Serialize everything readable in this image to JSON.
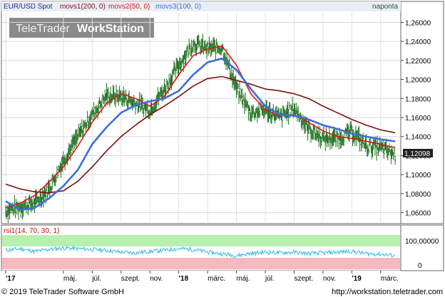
{
  "header": {
    "symbol": "EUR/USD Spot",
    "ma1": "movs1(200, 0)",
    "ma2": "movs2(50, 0)",
    "ma3": "movs3(100, 0)",
    "period": "naponta"
  },
  "watermark": {
    "brand": "TeleTrader",
    "product": "WorkStation"
  },
  "last_price": "1,12098",
  "rsi_panel": {
    "label": "rsi1(14, 70, 30, 1)",
    "ticks": [
      "100,00000",
      "0"
    ]
  },
  "x_axis_labels": [
    "'17",
    "máj.",
    "júl.",
    "szept.",
    "nov.",
    "'18",
    "márc.",
    "máj.",
    "júl.",
    "szept.",
    "nov.",
    "'19",
    "márc."
  ],
  "y_axis_labels": [
    "1,26000",
    "1,24000",
    "1,22000",
    "1,20000",
    "1,18000",
    "1,16000",
    "1,14000",
    "1,12000",
    "1,10000",
    "1,08000",
    "1,06000"
  ],
  "footer": {
    "copyright": "© 2019 TeleTrader Software GmbH",
    "url": "http://workstation.teletrader.com"
  },
  "colors": {
    "price": "#1c6e1c",
    "ma_200": "#7a1010",
    "ma_50": "#d61a1a",
    "ma_100": "#3a6fd9",
    "rsi": "#33b8e8",
    "rsi_overbought": "#b8f0b0",
    "rsi_oversold": "#f6b9c0"
  },
  "chart_data": {
    "type": "line",
    "ylim": [
      1.05,
      1.27
    ],
    "x_months": [
      "2017-01",
      "2017-02",
      "2017-03",
      "2017-04",
      "2017-05",
      "2017-06",
      "2017-07",
      "2017-08",
      "2017-09",
      "2017-10",
      "2017-11",
      "2017-12",
      "2018-01",
      "2018-02",
      "2018-03",
      "2018-04",
      "2018-05",
      "2018-06",
      "2018-07",
      "2018-08",
      "2018-09",
      "2018-10",
      "2018-11",
      "2018-12",
      "2019-01",
      "2019-02",
      "2019-03",
      "2019-04"
    ],
    "series": [
      {
        "name": "EUR/USD Spot",
        "style": "ohlc",
        "values": [
          1.062,
          1.066,
          1.07,
          1.085,
          1.115,
          1.14,
          1.163,
          1.183,
          1.182,
          1.175,
          1.168,
          1.19,
          1.215,
          1.238,
          1.232,
          1.234,
          1.19,
          1.165,
          1.168,
          1.16,
          1.17,
          1.148,
          1.138,
          1.138,
          1.145,
          1.13,
          1.128,
          1.121
        ]
      },
      {
        "name": "movs1(200, 0)",
        "values": [
          1.09,
          1.085,
          1.082,
          1.081,
          1.083,
          1.093,
          1.108,
          1.125,
          1.14,
          1.152,
          1.163,
          1.172,
          1.182,
          1.193,
          1.201,
          1.203,
          1.199,
          1.195,
          1.19,
          1.188,
          1.185,
          1.18,
          1.172,
          1.165,
          1.158,
          1.152,
          1.147,
          1.144
        ]
      },
      {
        "name": "movs2(50, 0)",
        "values": [
          1.065,
          1.07,
          1.078,
          1.092,
          1.108,
          1.13,
          1.155,
          1.175,
          1.185,
          1.18,
          1.172,
          1.182,
          1.205,
          1.225,
          1.232,
          1.235,
          1.215,
          1.185,
          1.168,
          1.162,
          1.163,
          1.155,
          1.146,
          1.14,
          1.138,
          1.135,
          1.132,
          1.128
        ]
      },
      {
        "name": "movs3(100, 0)",
        "values": [
          1.072,
          1.063,
          1.065,
          1.075,
          1.088,
          1.105,
          1.132,
          1.15,
          1.165,
          1.173,
          1.177,
          1.18,
          1.188,
          1.205,
          1.218,
          1.222,
          1.21,
          1.19,
          1.172,
          1.163,
          1.162,
          1.158,
          1.152,
          1.148,
          1.143,
          1.14,
          1.137,
          1.135
        ]
      }
    ],
    "rsi": {
      "name": "rsi1(14, 70, 30, 1)",
      "ylim": [
        0,
        100
      ],
      "overbought": 70,
      "oversold": 30,
      "values": [
        55,
        60,
        52,
        58,
        62,
        60,
        58,
        55,
        50,
        48,
        52,
        56,
        60,
        58,
        50,
        45,
        40,
        46,
        50,
        48,
        50,
        46,
        48,
        50,
        52,
        46,
        44,
        40
      ]
    }
  }
}
